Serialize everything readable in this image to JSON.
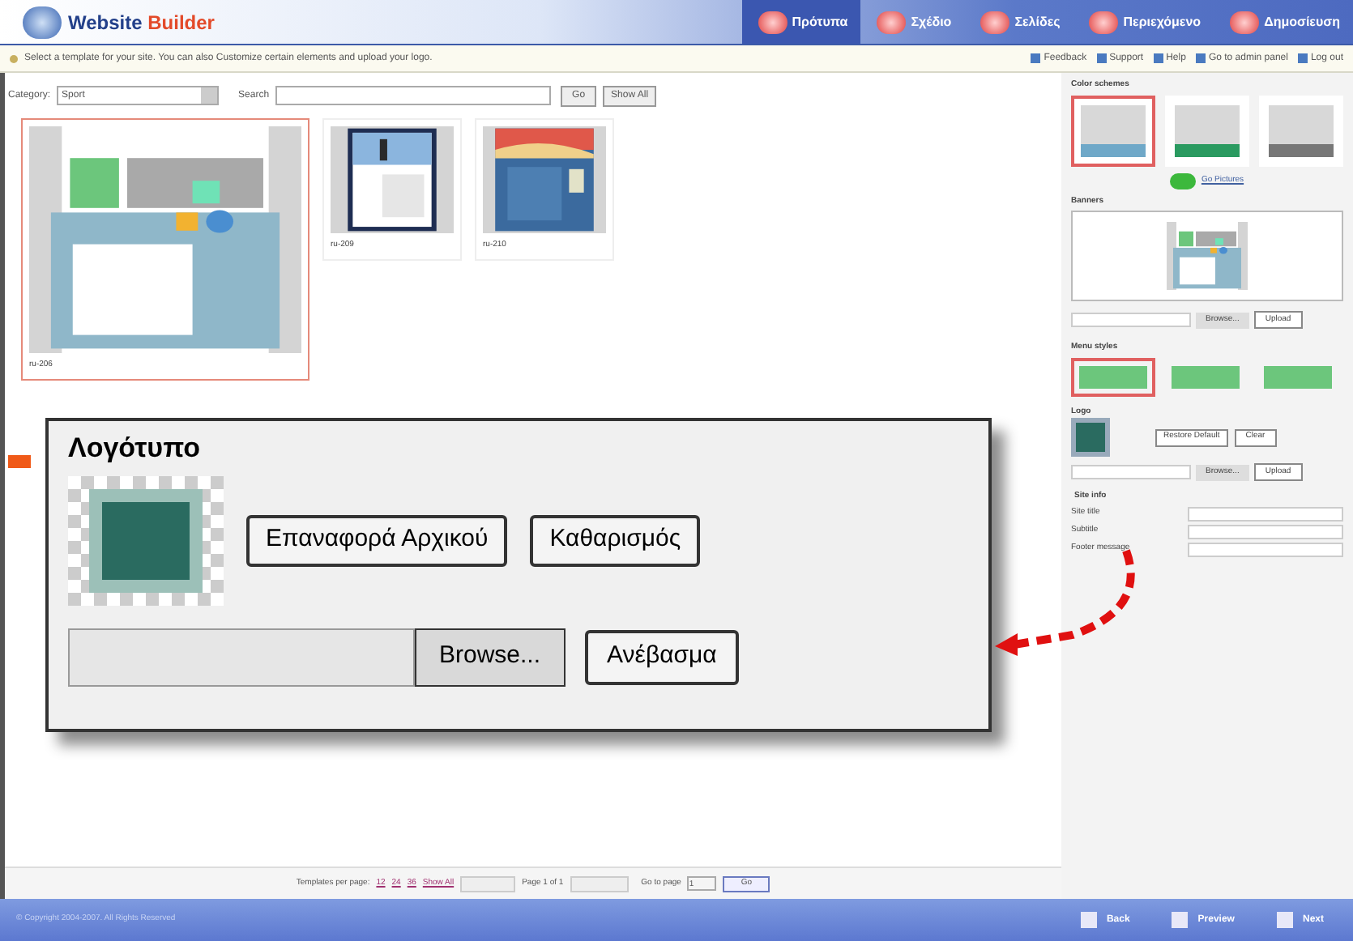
{
  "header": {
    "title_parts": [
      "Website ",
      "Builder"
    ],
    "steps": [
      {
        "label": "Πρότυπα",
        "selected": true
      },
      {
        "label": "Σχέδιο",
        "selected": false
      },
      {
        "label": "Σελίδες",
        "selected": false
      },
      {
        "label": "Περιεχόμενο",
        "selected": false
      },
      {
        "label": "Δημοσίευση",
        "selected": false
      }
    ]
  },
  "info_bar": {
    "message": "Select a template for your site. You can also Customize certain elements and upload your logo.",
    "links": [
      "Feedback",
      "Support",
      "Help",
      "Go to admin panel",
      "Log out"
    ]
  },
  "filter": {
    "category_label": "Category:",
    "category_value": "Sport",
    "search_label": "Search",
    "go": "Go",
    "show_all": "Show All"
  },
  "templates": [
    {
      "name": "ru-206",
      "selected": true
    },
    {
      "name": "ru-209",
      "selected": false
    },
    {
      "name": "ru-210",
      "selected": false
    }
  ],
  "pager": {
    "per_page_label": "Templates per page:",
    "per_page": [
      "12",
      "24",
      "36",
      "Show All"
    ],
    "page": "Page 1 of 1",
    "goto_label": "Go to page",
    "goto_value": "1",
    "go": "Go"
  },
  "footer": {
    "copyright": "© Copyright 2004-2007. All Rights Reserved",
    "nav": [
      "Back",
      "Preview",
      "Next"
    ]
  },
  "side": {
    "color_title": "Color schemes",
    "schemes": [
      {
        "color": "#6fa8c8",
        "selected": true
      },
      {
        "color": "#2a9a60",
        "selected": false
      },
      {
        "color": "#777777",
        "selected": false
      }
    ],
    "pictures_link": "Go Pictures",
    "banners_title": "Banners",
    "browse": "Browse...",
    "upload": "Upload",
    "menu_title": "Menu styles",
    "menus": [
      {
        "selected": true
      },
      {
        "selected": false
      },
      {
        "selected": false
      }
    ],
    "logo_title": "Logo",
    "restore": "Restore Default",
    "clear": "Clear",
    "browse2": "Browse...",
    "upload2": "Upload",
    "site_title": "Site info",
    "fields": [
      "Site title",
      "Subtitle",
      "Footer message"
    ]
  },
  "callout": {
    "title": "Λογότυπο",
    "restore": "Επαναφορά Αρχικού",
    "clear": "Καθαρισμός",
    "browse": "Browse...",
    "upload": "Ανέβασμα"
  }
}
